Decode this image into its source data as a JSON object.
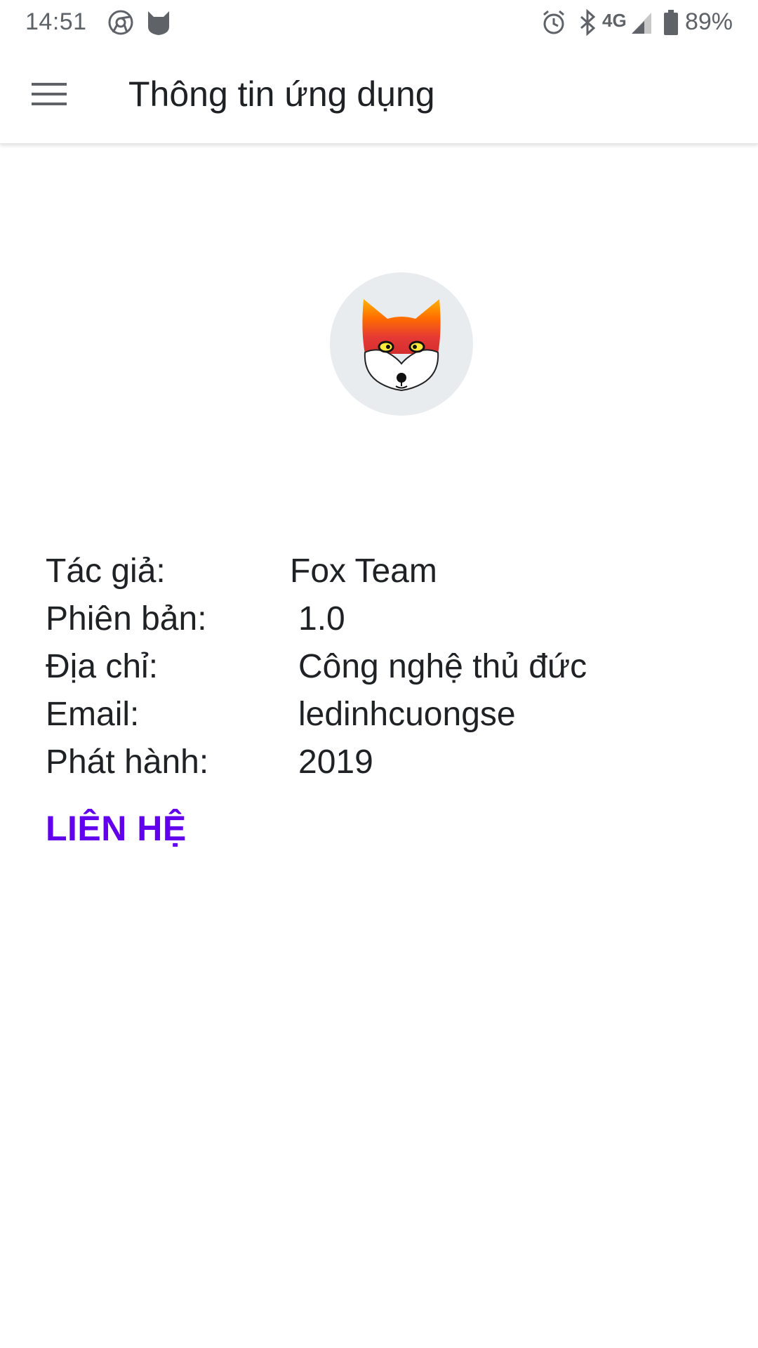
{
  "status_bar": {
    "time": "14:51",
    "network": "4G",
    "battery": "89%",
    "icons": [
      "chrome-icon",
      "fox-notification-icon",
      "alarm-icon",
      "bluetooth-icon",
      "signal-icon",
      "battery-icon"
    ]
  },
  "app_bar": {
    "title": "Thông tin ứng dụng",
    "menu_icon": "hamburger-menu-icon"
  },
  "logo": {
    "icon": "fox-logo-icon"
  },
  "info": {
    "rows": [
      {
        "label": "Tác giả:",
        "value": "Fox Team"
      },
      {
        "label": "Phiên bản:",
        "value": "1.0"
      },
      {
        "label": "Địa chỉ:",
        "value": "Công nghệ thủ đức"
      },
      {
        "label": "Email:",
        "value": "ledinhcuongse"
      },
      {
        "label": "Phát hành:",
        "value": "2019"
      }
    ]
  },
  "contact_button": {
    "label": "LIÊN HỆ",
    "color": "#6200ee"
  }
}
